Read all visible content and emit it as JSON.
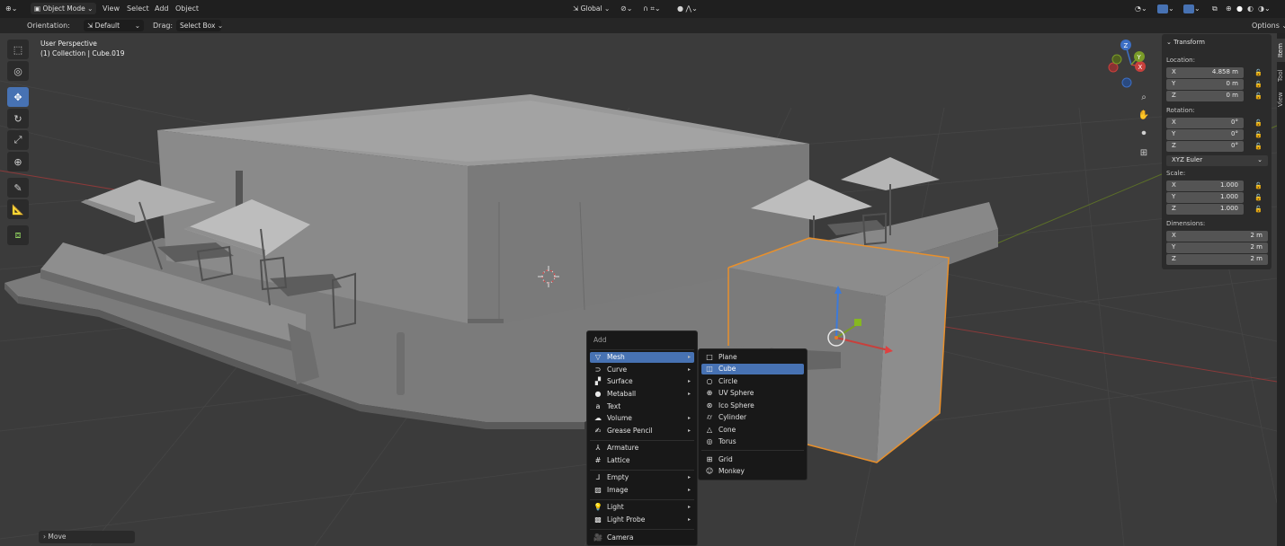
{
  "header": {
    "mode": "Object Mode",
    "menus": [
      "View",
      "Select",
      "Add",
      "Object"
    ],
    "transform_orientation": "Global"
  },
  "tool_options": {
    "orientation_label": "Orientation:",
    "orientation_value": "Default",
    "drag_label": "Drag:",
    "drag_value": "Select Box",
    "options": "Options"
  },
  "viewport": {
    "view_name": "User Perspective",
    "collection_info": "(1) Collection | Cube.019"
  },
  "toolbar": [
    "select-box",
    "cursor",
    "move",
    "rotate",
    "scale",
    "transform",
    "annotate",
    "measure",
    "add-cube"
  ],
  "n_panel": {
    "section": "Transform",
    "location_label": "Location:",
    "location": [
      {
        "axis": "X",
        "value": "4.858 m"
      },
      {
        "axis": "Y",
        "value": "0 m"
      },
      {
        "axis": "Z",
        "value": "0 m"
      }
    ],
    "rotation_label": "Rotation:",
    "rotation": [
      {
        "axis": "X",
        "value": "0°"
      },
      {
        "axis": "Y",
        "value": "0°"
      },
      {
        "axis": "Z",
        "value": "0°"
      }
    ],
    "rotation_mode": "XYZ Euler",
    "scale_label": "Scale:",
    "scale": [
      {
        "axis": "X",
        "value": "1.000"
      },
      {
        "axis": "Y",
        "value": "1.000"
      },
      {
        "axis": "Z",
        "value": "1.000"
      }
    ],
    "dimensions_label": "Dimensions:",
    "dimensions": [
      {
        "axis": "X",
        "value": "2 m"
      },
      {
        "axis": "Y",
        "value": "2 m"
      },
      {
        "axis": "Z",
        "value": "2 m"
      }
    ]
  },
  "side_tabs": [
    "Item",
    "Tool",
    "View"
  ],
  "last_operator": "Move",
  "add_menu": {
    "title": "Add",
    "items": [
      {
        "label": "Mesh",
        "icon": "mesh-icon",
        "submenu": true,
        "highlight": true
      },
      {
        "label": "Curve",
        "icon": "curve-icon",
        "submenu": true
      },
      {
        "label": "Surface",
        "icon": "surface-icon",
        "submenu": true
      },
      {
        "label": "Metaball",
        "icon": "metaball-icon",
        "submenu": true
      },
      {
        "label": "Text",
        "icon": "text-icon",
        "submenu": false
      },
      {
        "label": "Volume",
        "icon": "volume-icon",
        "submenu": true
      },
      {
        "label": "Grease Pencil",
        "icon": "grease-pencil-icon",
        "submenu": true
      },
      {
        "label": "Armature",
        "icon": "armature-icon",
        "submenu": false
      },
      {
        "label": "Lattice",
        "icon": "lattice-icon",
        "submenu": false
      },
      {
        "label": "Empty",
        "icon": "empty-icon",
        "submenu": true
      },
      {
        "label": "Image",
        "icon": "image-icon",
        "submenu": true
      },
      {
        "label": "Light",
        "icon": "light-icon",
        "submenu": true
      },
      {
        "label": "Light Probe",
        "icon": "light-probe-icon",
        "submenu": true
      },
      {
        "label": "Camera",
        "icon": "camera-icon",
        "submenu": false
      }
    ]
  },
  "mesh_menu": {
    "items": [
      {
        "label": "Plane",
        "icon": "plane-icon"
      },
      {
        "label": "Cube",
        "icon": "cube-icon",
        "highlight": true
      },
      {
        "label": "Circle",
        "icon": "circle-icon"
      },
      {
        "label": "UV Sphere",
        "icon": "uv-sphere-icon"
      },
      {
        "label": "Ico Sphere",
        "icon": "ico-sphere-icon"
      },
      {
        "label": "Cylinder",
        "icon": "cylinder-icon"
      },
      {
        "label": "Cone",
        "icon": "cone-icon"
      },
      {
        "label": "Torus",
        "icon": "torus-icon"
      },
      {
        "label": "Grid",
        "icon": "grid-icon"
      },
      {
        "label": "Monkey",
        "icon": "monkey-icon"
      }
    ]
  },
  "colors": {
    "accent": "#4772b3",
    "selection": "#e8902c",
    "x_axis": "#c8403c",
    "y_axis": "#7a9c28"
  }
}
